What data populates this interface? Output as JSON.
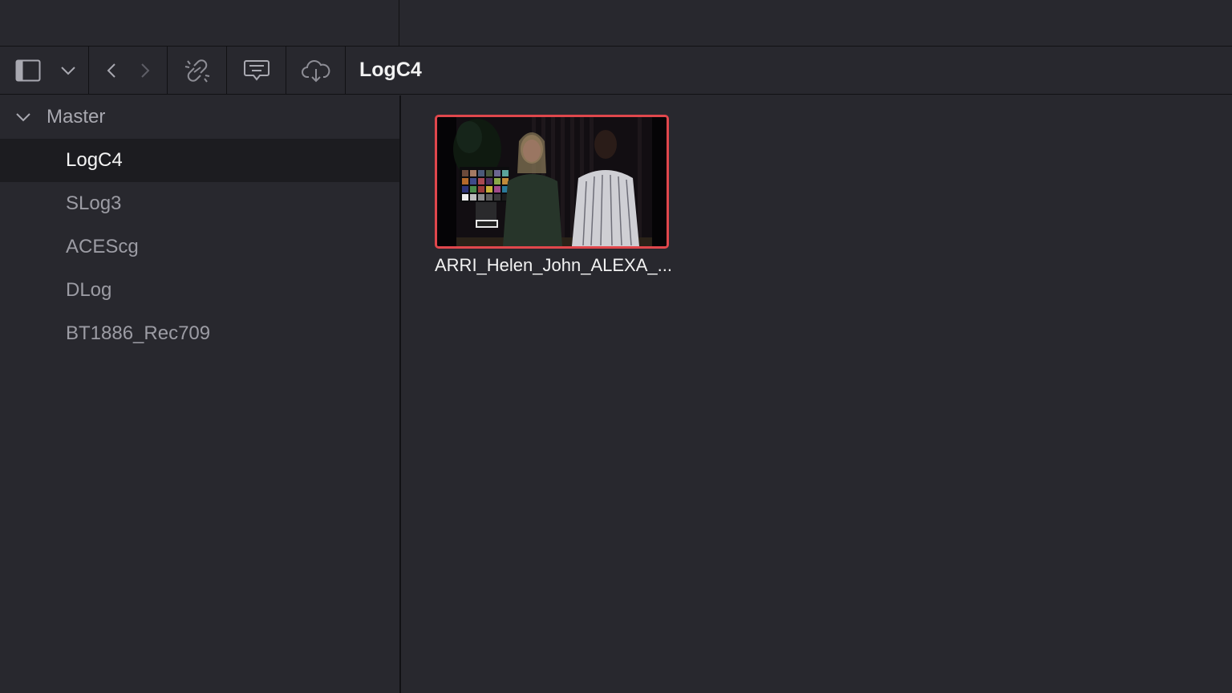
{
  "header": {
    "breadcrumb": "LogC4"
  },
  "toolbar": {
    "icons": [
      "sidebar-toggle-icon",
      "chevron-down-icon",
      "back-arrow-icon",
      "forward-arrow-icon",
      "unlink-icon",
      "caption-icon",
      "cloud-download-icon"
    ]
  },
  "sidebar": {
    "root_label": "Master",
    "items": [
      {
        "label": "LogC4",
        "selected": true
      },
      {
        "label": "SLog3",
        "selected": false
      },
      {
        "label": "ACEScg",
        "selected": false
      },
      {
        "label": "DLog",
        "selected": false
      },
      {
        "label": "BT1886_Rec709",
        "selected": false
      }
    ]
  },
  "media_pool": {
    "clips": [
      {
        "name": "ARRI_Helen_John_ALEXA_...",
        "selected": true
      }
    ]
  },
  "colors": {
    "accent_selection": "#e0474c",
    "background": "#28282e",
    "selected_row": "#1c1c20"
  }
}
